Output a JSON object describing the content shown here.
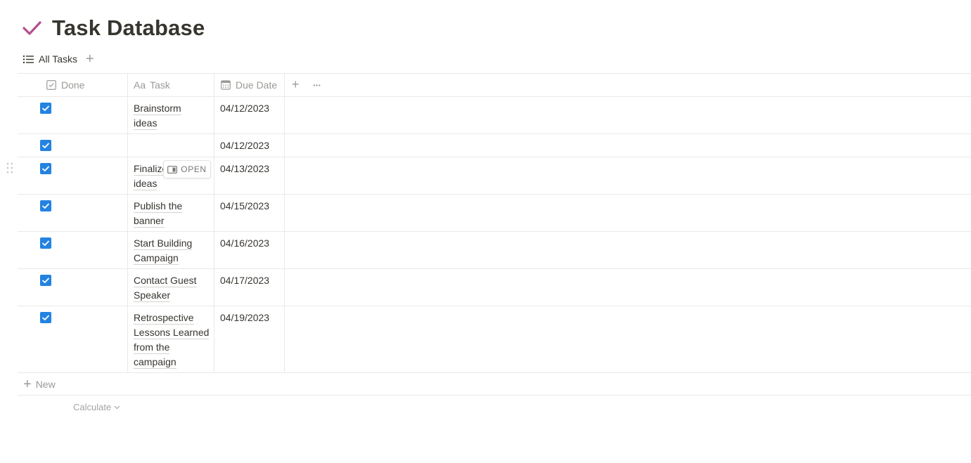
{
  "page": {
    "title": "Task Database",
    "icon": "checkmark-icon",
    "icon_color": "#b44f8c"
  },
  "views": {
    "active_tab": "All Tasks",
    "active_tab_icon": "list-icon",
    "add_view_label": "+"
  },
  "table": {
    "columns": [
      {
        "label": "Done",
        "icon": "checkbox-property-icon"
      },
      {
        "label": "Task",
        "icon_text": "Aa"
      },
      {
        "label": "Due Date",
        "icon": "calendar-icon"
      }
    ],
    "add_column_label": "+",
    "more_label": "···",
    "checkbox_color": "#2383e2",
    "rows": [
      {
        "done": true,
        "task": [
          "Brainstorm",
          "ideas"
        ],
        "due": "04/12/2023"
      },
      {
        "done": true,
        "task": [],
        "due": "04/12/2023"
      },
      {
        "done": true,
        "task": [
          "Finalize",
          "ideas"
        ],
        "due": "04/13/2023"
      },
      {
        "done": true,
        "task": [
          "Publish the",
          "banner"
        ],
        "due": "04/15/2023"
      },
      {
        "done": true,
        "task": [
          "Start Building",
          "Campaign"
        ],
        "due": "04/16/2023"
      },
      {
        "done": true,
        "task": [
          "Contact Guest",
          "Speaker"
        ],
        "due": "04/17/2023"
      },
      {
        "done": true,
        "task": [
          "Retrospective",
          "Lessons Learned",
          "from the",
          "campaign"
        ],
        "due": "04/19/2023"
      }
    ],
    "open_button_label": "OPEN",
    "new_row_label": "New",
    "calculate_label": "Calculate"
  }
}
